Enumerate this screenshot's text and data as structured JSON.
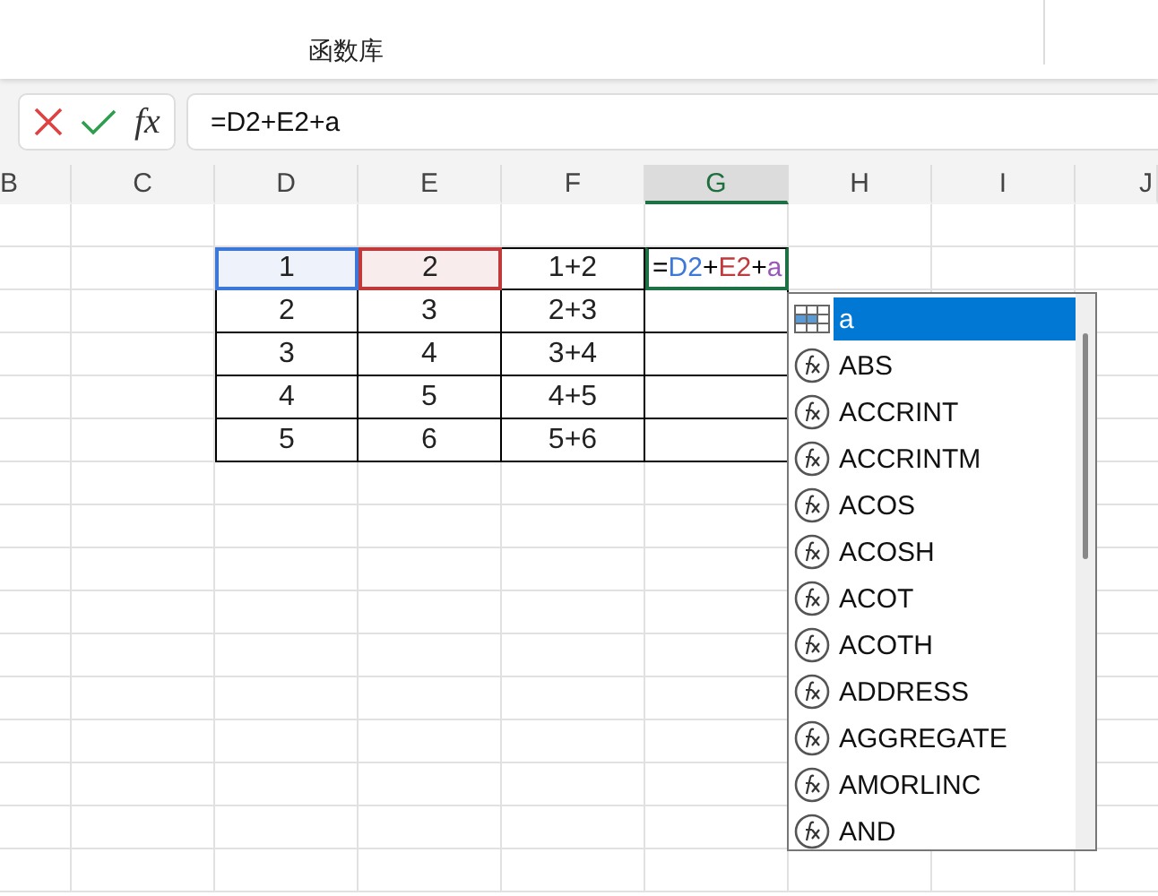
{
  "ribbon": {
    "group_label": "函数库"
  },
  "formula_bar": {
    "function_button": "fx",
    "value": "=D2+E2+a"
  },
  "columns": [
    {
      "label": "B",
      "selected": false
    },
    {
      "label": "C",
      "selected": false
    },
    {
      "label": "D",
      "selected": false
    },
    {
      "label": "E",
      "selected": false
    },
    {
      "label": "F",
      "selected": false
    },
    {
      "label": "G",
      "selected": true
    },
    {
      "label": "H",
      "selected": false
    },
    {
      "label": "I",
      "selected": false
    },
    {
      "label": "J",
      "selected": false
    }
  ],
  "table": {
    "rows": [
      {
        "cells": [
          {
            "text": "1",
            "color": "#3c78d8"
          },
          {
            "text": "2",
            "color": "#c0393b"
          },
          {
            "text": "1+2"
          }
        ]
      },
      {
        "cells": [
          {
            "text": "2"
          },
          {
            "text": "3"
          },
          {
            "text": "2+3"
          }
        ]
      },
      {
        "cells": [
          {
            "text": "3"
          },
          {
            "text": "4"
          },
          {
            "text": "3+4"
          }
        ]
      },
      {
        "cells": [
          {
            "text": "4"
          },
          {
            "text": "5"
          },
          {
            "text": "4+5"
          }
        ]
      },
      {
        "cells": [
          {
            "text": "5"
          },
          {
            "text": "6"
          },
          {
            "text": "5+6"
          }
        ]
      }
    ]
  },
  "editing_cell": {
    "parts": [
      {
        "text": "=",
        "color": "#000000"
      },
      {
        "text": "D2",
        "color": "#3c78d8"
      },
      {
        "text": "+",
        "color": "#000000"
      },
      {
        "text": "E2",
        "color": "#c0393b"
      },
      {
        "text": "+",
        "color": "#000000"
      },
      {
        "text": "a",
        "color": "#9b59b6"
      }
    ]
  },
  "autocomplete": {
    "items": [
      {
        "label": "a",
        "kind": "name",
        "selected": true
      },
      {
        "label": "ABS",
        "kind": "function",
        "selected": false
      },
      {
        "label": "ACCRINT",
        "kind": "function",
        "selected": false
      },
      {
        "label": "ACCRINTM",
        "kind": "function",
        "selected": false
      },
      {
        "label": "ACOS",
        "kind": "function",
        "selected": false
      },
      {
        "label": "ACOSH",
        "kind": "function",
        "selected": false
      },
      {
        "label": "ACOT",
        "kind": "function",
        "selected": false
      },
      {
        "label": "ACOTH",
        "kind": "function",
        "selected": false
      },
      {
        "label": "ADDRESS",
        "kind": "function",
        "selected": false
      },
      {
        "label": "AGGREGATE",
        "kind": "function",
        "selected": false
      },
      {
        "label": "AMORLINC",
        "kind": "function",
        "selected": false
      },
      {
        "label": "AND",
        "kind": "function",
        "selected": false
      }
    ]
  }
}
